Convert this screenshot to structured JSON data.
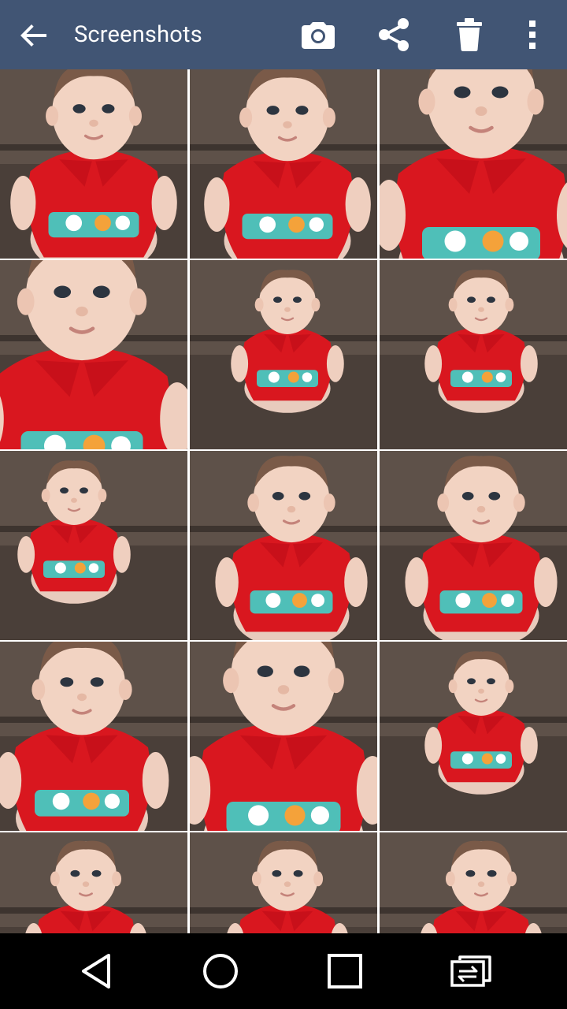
{
  "app_bar": {
    "title": "Screenshots",
    "background": "#415574",
    "icons": [
      "back-arrow-icon",
      "camera-icon",
      "share-icon",
      "trash-icon",
      "more-vert-icon"
    ]
  },
  "grid": {
    "columns": 3,
    "items": [
      {
        "label": "photo-1"
      },
      {
        "label": "photo-2"
      },
      {
        "label": "photo-3"
      },
      {
        "label": "photo-4"
      },
      {
        "label": "photo-5"
      },
      {
        "label": "photo-6"
      },
      {
        "label": "photo-7"
      },
      {
        "label": "photo-8"
      },
      {
        "label": "photo-9"
      },
      {
        "label": "photo-10"
      },
      {
        "label": "photo-11"
      },
      {
        "label": "photo-12"
      },
      {
        "label": "photo-13"
      },
      {
        "label": "photo-14"
      },
      {
        "label": "photo-15"
      }
    ]
  },
  "nav_bar": {
    "icons": [
      "back-triangle-icon",
      "home-circle-icon",
      "recents-square-icon",
      "screen-switch-icon"
    ]
  }
}
